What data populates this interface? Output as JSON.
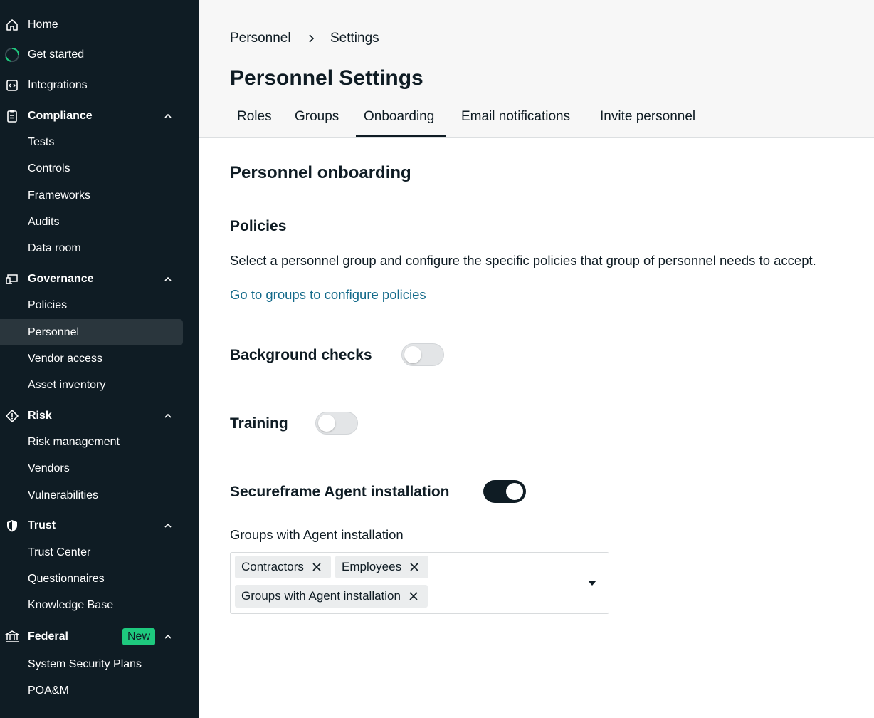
{
  "sidebar": {
    "items": [
      {
        "label": "Home",
        "icon": "home-icon"
      },
      {
        "label": "Get started",
        "icon": "progress-ring-icon"
      },
      {
        "label": "Integrations",
        "icon": "integrations-icon"
      },
      {
        "label": "Compliance",
        "icon": "clipboard-icon"
      },
      {
        "label": "Tests"
      },
      {
        "label": "Controls"
      },
      {
        "label": "Frameworks"
      },
      {
        "label": "Audits"
      },
      {
        "label": "Data room"
      },
      {
        "label": "Governance",
        "icon": "devices-icon"
      },
      {
        "label": "Policies"
      },
      {
        "label": "Personnel"
      },
      {
        "label": "Vendor access"
      },
      {
        "label": "Asset inventory"
      },
      {
        "label": "Risk",
        "icon": "risk-diamond-icon"
      },
      {
        "label": "Risk management"
      },
      {
        "label": "Vendors"
      },
      {
        "label": "Vulnerabilities"
      },
      {
        "label": "Trust",
        "icon": "shield-icon"
      },
      {
        "label": "Trust Center"
      },
      {
        "label": "Questionnaires"
      },
      {
        "label": "Knowledge Base"
      },
      {
        "label": "Federal",
        "icon": "bank-icon",
        "badge": "New"
      },
      {
        "label": "System Security Plans"
      },
      {
        "label": "POA&M"
      }
    ]
  },
  "header": {
    "breadcrumb": [
      "Personnel",
      "Settings"
    ],
    "title": "Personnel Settings",
    "tabs": [
      "Roles",
      "Groups",
      "Onboarding",
      "Email notifications",
      "Invite personnel"
    ],
    "active_tab": "Onboarding"
  },
  "content": {
    "heading": "Personnel onboarding",
    "policies": {
      "heading": "Policies",
      "description": "Select a personnel group and configure the specific policies that group of personnel needs to accept.",
      "link": "Go to groups to configure policies"
    },
    "background_checks": {
      "label": "Background checks",
      "enabled": false
    },
    "training": {
      "label": "Training",
      "enabled": false
    },
    "agent": {
      "label": "Secureframe Agent installation",
      "enabled": true,
      "groups_label": "Groups with Agent installation",
      "selected_groups": [
        "Contractors",
        "Employees",
        "Groups with Agent installation"
      ]
    }
  },
  "colors": {
    "sidebar_bg": "#0f1c24",
    "active_item_bg": "#2a363d",
    "badge_green": "#1ec97e",
    "link": "#146a8a",
    "toggle_on": "#0f1c24"
  }
}
